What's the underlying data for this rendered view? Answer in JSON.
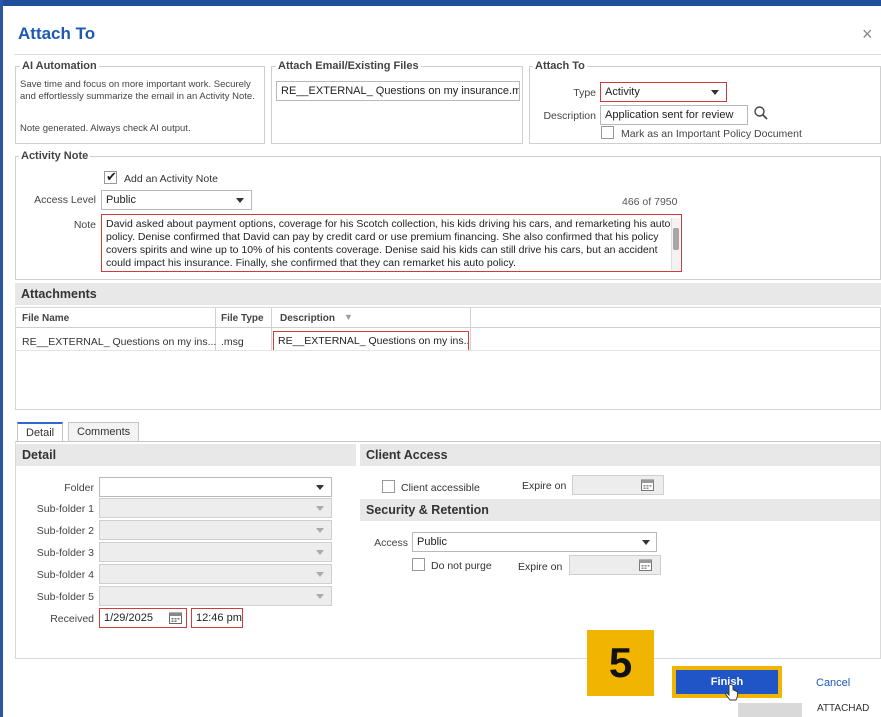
{
  "dialog": {
    "title": "Attach To",
    "close_glyph": "×"
  },
  "ai_automation": {
    "legend": "AI Automation",
    "description": "Save time and focus on more important work. Securely and effortlessly summarize the email in an Activity Note.",
    "note": "Note generated. Always check AI output."
  },
  "attach_email": {
    "legend": "Attach Email/Existing Files",
    "file": "RE__EXTERNAL_ Questions on my insurance.msg"
  },
  "attach_to": {
    "legend": "Attach To",
    "type_label": "Type",
    "type_value": "Activity",
    "description_label": "Description",
    "description_value": "Application sent for review",
    "important_label": "Mark as an Important Policy Document"
  },
  "activity_note": {
    "legend": "Activity Note",
    "add_note_label": "Add an Activity Note",
    "access_label": "Access Level",
    "access_value": "Public",
    "counter": "466 of 7950",
    "note_label": "Note",
    "note_text": "David asked about payment options, coverage for his Scotch collection, his kids driving his cars, and remarketing his auto policy. Denise confirmed that David can pay by credit card or use premium financing. She also confirmed that his policy covers spirits and wine up to 10% of his contents coverage. Denise said his kids can still drive his cars, but an accident could impact his insurance. Finally, she confirmed that they can remarket his auto policy."
  },
  "attachments": {
    "title": "Attachments",
    "columns": [
      "File Name",
      "File Type",
      "Description"
    ],
    "rows": [
      {
        "file_name": "RE__EXTERNAL_ Questions on my ins...",
        "file_type": ".msg",
        "description": "RE__EXTERNAL_ Questions on my ins..."
      }
    ]
  },
  "tabs": [
    "Detail",
    "Comments"
  ],
  "detail": {
    "title": "Detail",
    "folder_label": "Folder",
    "subfolder_labels": [
      "Sub-folder 1",
      "Sub-folder 2",
      "Sub-folder 3",
      "Sub-folder 4",
      "Sub-folder 5"
    ],
    "received_label": "Received",
    "received_date": "1/29/2025",
    "received_time": "12:46 pm"
  },
  "client_access": {
    "title": "Client Access",
    "accessible_label": "Client accessible",
    "expire_label": "Expire on"
  },
  "security": {
    "title": "Security & Retention",
    "access_label": "Access",
    "access_value": "Public",
    "purge_label": "Do not purge",
    "expire_label": "Expire on"
  },
  "footer": {
    "step_number": "5",
    "finish_label": "Finish",
    "cancel_label": "Cancel",
    "status_text": "ATTACHAD"
  },
  "colors": {
    "accent": "#1e5bb0",
    "highlight": "#f1b400",
    "error_border": "#d23b3b"
  }
}
